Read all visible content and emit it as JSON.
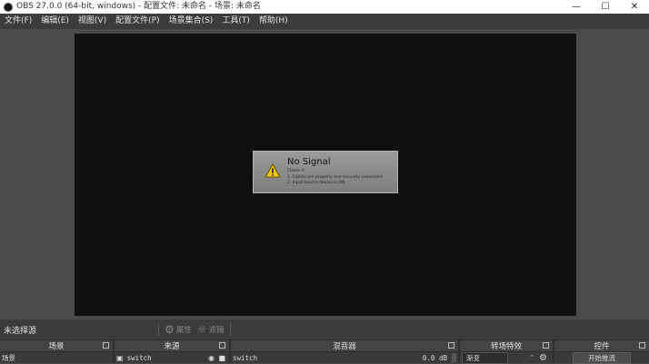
{
  "window": {
    "title": "OBS 27.0.0 (64-bit, windows) - 配置文件: 未命名 - 场景: 未命名"
  },
  "menu": [
    "文件(F)",
    "编辑(E)",
    "视图(V)",
    "配置文件(P)",
    "场景集合(S)",
    "工具(T)",
    "帮助(H)"
  ],
  "nosignal": {
    "title": "No Signal",
    "check": "Check if:",
    "lines": [
      "1. Cables are properly and securely connected",
      "2. Input source device is ON"
    ]
  },
  "status": {
    "no_source": "未选择源",
    "properties": "属性",
    "filters": "滤镜"
  },
  "docks": {
    "scenes": {
      "title": "场景",
      "item": "场景"
    },
    "sources": {
      "title": "来源",
      "item": "switch"
    },
    "mixer": {
      "title": "混音器",
      "item": "switch",
      "db": "0.0 dB"
    },
    "transitions": {
      "title": "转场特效",
      "item": "渐变"
    },
    "controls": {
      "title": "控件",
      "start_stream": "开始推流"
    }
  },
  "colors": {
    "accent": "#e0b000"
  }
}
